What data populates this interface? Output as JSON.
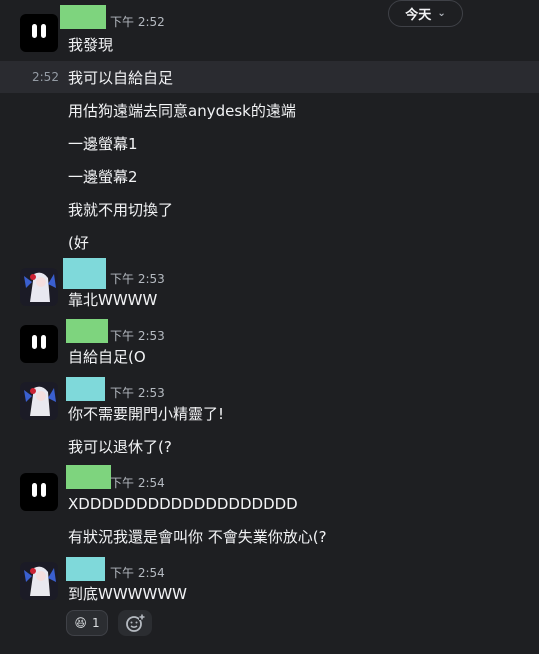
{
  "header": {
    "date_filter": "今天"
  },
  "groups": [
    {
      "time": "下午 2:52",
      "first_line": "我發現"
    },
    {
      "time": "下午 2:53",
      "first_line": "靠北WWWW"
    },
    {
      "time": "下午 2:53",
      "first_line": "自給自足(O"
    },
    {
      "time": "下午 2:53",
      "first_line": "你不需要開門小精靈了!"
    },
    {
      "time": "下午 2:54",
      "first_line": "XDDDDDDDDDDDDDDDDDDD"
    },
    {
      "time": "下午 2:54",
      "first_line": "到底WWWWWW"
    }
  ],
  "continuations": {
    "hover_time": "2:52",
    "g1": [
      "我可以自給自足",
      "用估狗遠端去同意anydesk的遠端",
      "一邊螢幕1",
      "一邊螢幕2",
      "我就不用切換了",
      "(好"
    ],
    "g4": [
      "我可以退休了(?"
    ],
    "g5": [
      "有狀況我還是會叫你 不會失業你放心(?"
    ]
  },
  "reaction": {
    "emoji": "😆",
    "count": "1"
  },
  "colors": {
    "green_name": "#7ed47e",
    "cyan_name": "#7fd9da"
  }
}
